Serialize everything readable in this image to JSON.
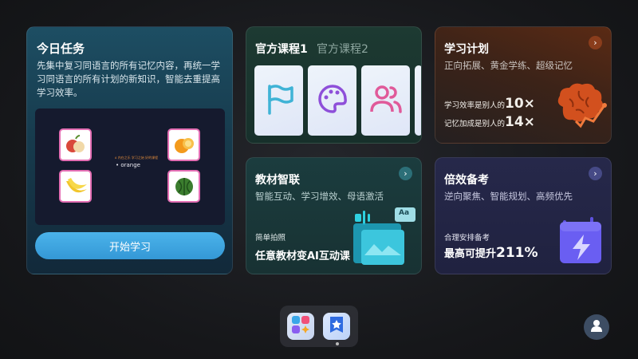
{
  "today_task": {
    "title": "今日任务",
    "description": "先集中复习同语言的所有记忆内容，再统一学习同语言的所有计划的新知识，智能去重提高学习效率。",
    "preview": {
      "caption": "ᴀ 内在之乐 学习之始 好的课程",
      "word": "• orange",
      "fruits": [
        "apple",
        "orange",
        "banana",
        "watermelon"
      ]
    },
    "start_button": "开始学习"
  },
  "courses": {
    "tabs": [
      "官方课程1",
      "官方课程2"
    ],
    "thumbnails": [
      "flag-icon",
      "palette-icon",
      "users-icon"
    ]
  },
  "study_plan": {
    "title": "学习计划",
    "subtitle": "正向拓展、黄金学练、超级记忆",
    "stat1_prefix": "学习效率是别人的",
    "stat1_value": "10×",
    "stat2_prefix": "记忆加成是别人的",
    "stat2_value": "14×",
    "accent": "#e0642a"
  },
  "textbook": {
    "title": "教材智联",
    "subtitle": "智能互动、学习增效、母语激活",
    "label": "简单拍照",
    "headline": "任意教材变AI互动课",
    "badge": "Aa"
  },
  "exam": {
    "title": "倍效备考",
    "subtitle": "逆向聚焦、智能规划、高频优先",
    "label": "合理安排备考",
    "headline_prefix": "最高可提升",
    "headline_value": "211%",
    "accent": "#6b5cf0"
  },
  "dock": {
    "apps": [
      "apps-grid-icon",
      "star-app-icon"
    ]
  }
}
